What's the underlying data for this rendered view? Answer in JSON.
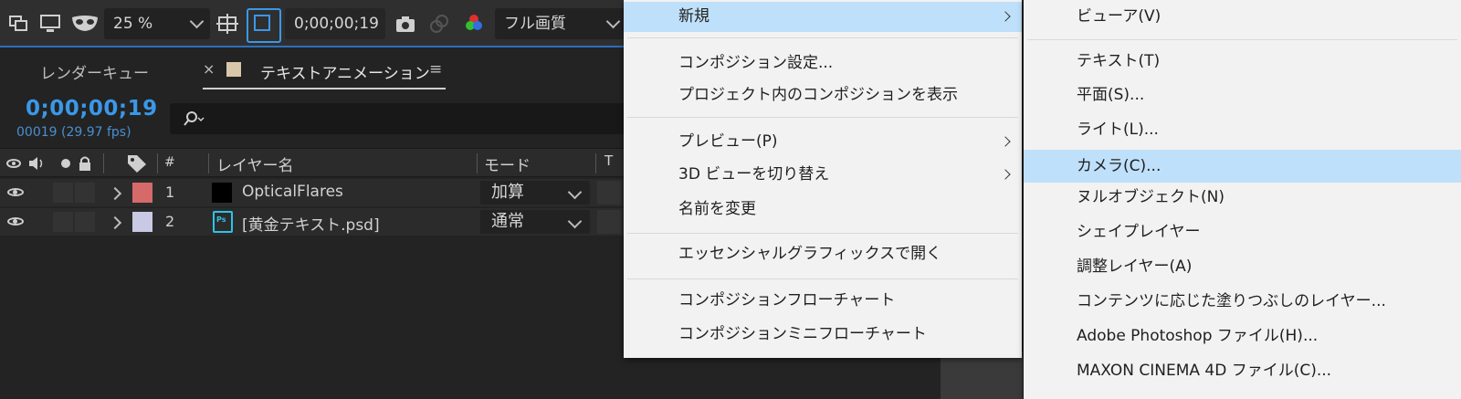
{
  "toolbar": {
    "zoom": "25 %",
    "timecode": "0;00;00;19",
    "quality": "フル画質"
  },
  "timeline": {
    "tabs": [
      "レンダーキュー",
      "テキストアニメーション"
    ],
    "tab_close": "×",
    "tab_menu": "≡",
    "timecode": "0;00;00;19",
    "frame_info": "00019 (29.97 fps)",
    "search_placeholder": "",
    "columns": {
      "hash": "#",
      "layer_name": "レイヤー名",
      "mode": "モード",
      "t": "T"
    },
    "layers": [
      {
        "index": "1",
        "name": "OpticalFlares",
        "mode": "加算",
        "label_color": "#d66a6a",
        "thumb_color": "#000000"
      },
      {
        "index": "2",
        "name": "[黄金テキスト.psd]",
        "mode": "通常",
        "label_color": "#c9c9e6",
        "thumb_color": "#1c2f3c"
      }
    ]
  },
  "layer_menu": {
    "items": [
      {
        "label": "新規",
        "submenu": true,
        "highlighted": true
      },
      {
        "label": "コンポジション設定..."
      },
      {
        "label": "プロジェクト内のコンポジションを表示"
      },
      {
        "label": "プレビュー(P)",
        "submenu": true
      },
      {
        "label": "3D ビューを切り替え",
        "submenu": true
      },
      {
        "label": "名前を変更"
      },
      {
        "label": "エッセンシャルグラフィックスで開く"
      },
      {
        "label": "コンポジションフローチャート"
      },
      {
        "label": "コンポジションミニフローチャート"
      }
    ]
  },
  "new_submenu": {
    "items": [
      {
        "label": "ビューア(V)"
      },
      {
        "label": "テキスト(T)"
      },
      {
        "label": "平面(S)..."
      },
      {
        "label": "ライト(L)..."
      },
      {
        "label": "カメラ(C)...",
        "highlighted": true
      },
      {
        "label": "ヌルオブジェクト(N)"
      },
      {
        "label": "シェイプレイヤー"
      },
      {
        "label": "調整レイヤー(A)"
      },
      {
        "label": "コンテンツに応じた塗りつぶしのレイヤー..."
      },
      {
        "label": "Adobe Photoshop ファイル(H)..."
      },
      {
        "label": "MAXON CINEMA 4D ファイル(C)..."
      }
    ]
  },
  "colors": {
    "accent_blue": "#3a98e8",
    "menu_bg": "#f2f2f2",
    "menu_highlight": "#bfe0fa"
  }
}
